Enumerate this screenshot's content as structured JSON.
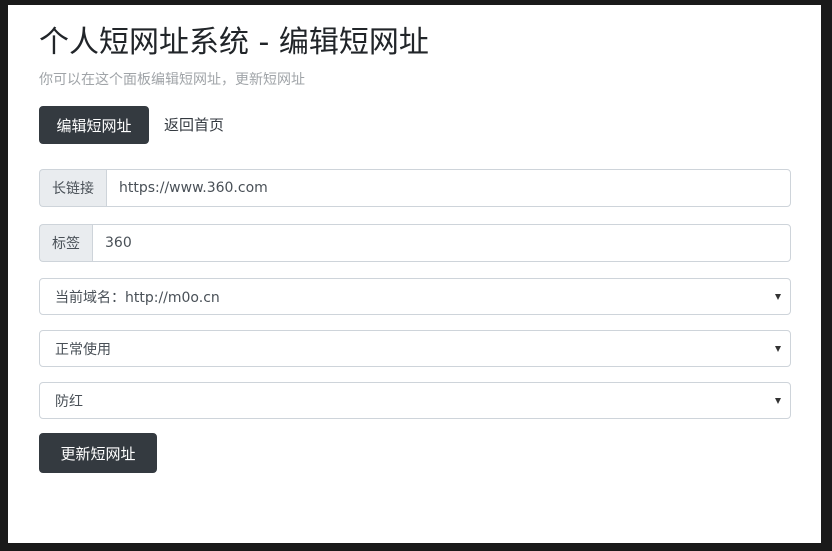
{
  "header": {
    "title": "个人短网址系统 - 编辑短网址",
    "subtitle": "你可以在这个面板编辑短网址，更新短网址"
  },
  "nav": {
    "active_label": "编辑短网址",
    "back_label": "返回首页"
  },
  "form": {
    "long_url": {
      "label": "长链接",
      "value": "https://www.360.com"
    },
    "tag": {
      "label": "标签",
      "value": "360"
    },
    "domain_select": {
      "value": "当前域名：http://m0o.cn"
    },
    "status_select": {
      "value": "正常使用"
    },
    "protection_select": {
      "value": "防红"
    },
    "submit_label": "更新短网址"
  },
  "colors": {
    "button_dark": "#343a40",
    "addon_bg": "#e9ecef",
    "border": "#ced4da"
  }
}
